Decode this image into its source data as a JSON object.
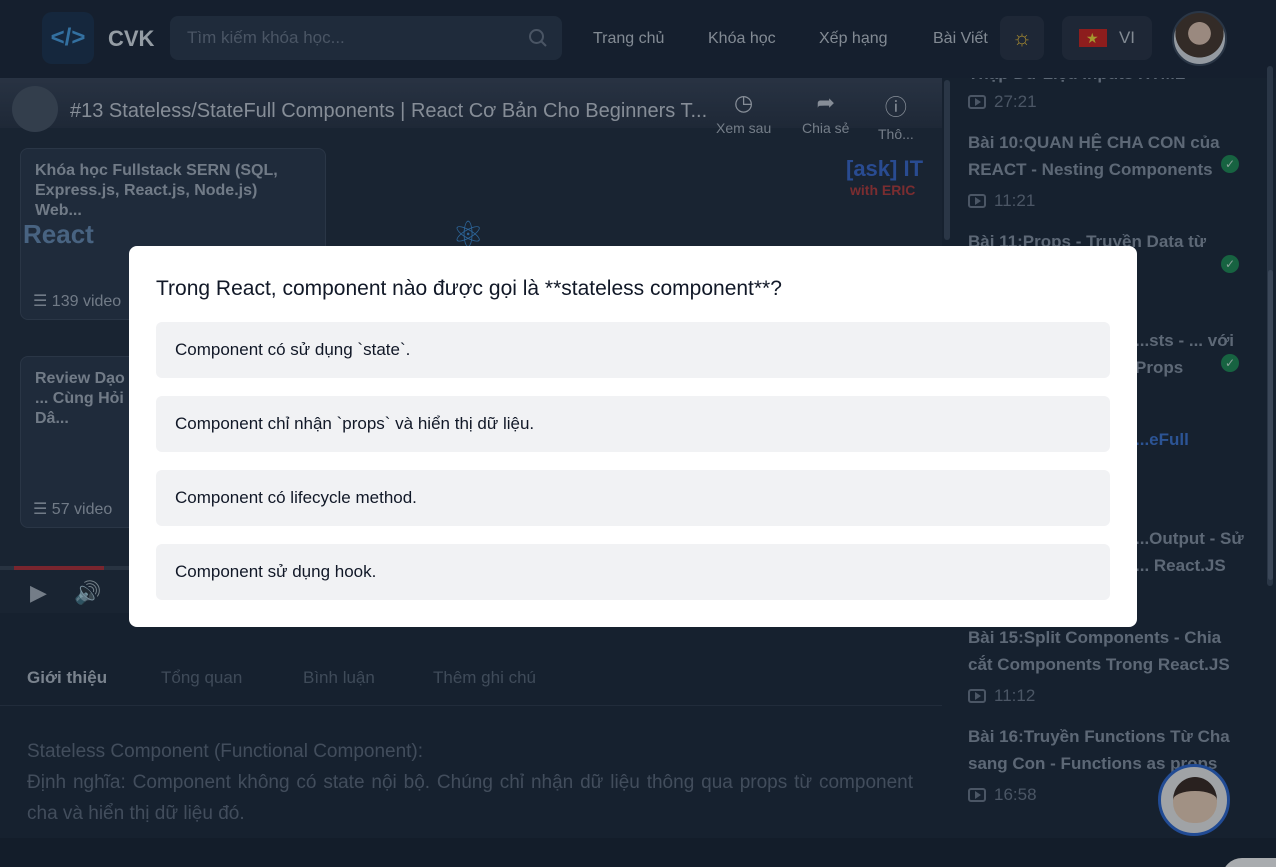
{
  "header": {
    "logo_text": "CVK",
    "search_placeholder": "Tìm kiếm khóa học...",
    "nav": [
      "Trang chủ",
      "Khóa học",
      "Xếp hạng",
      "Bài Viết"
    ],
    "lang_label": "VI"
  },
  "video": {
    "title": "#13 Stateless/StateFull Components | React Cơ Bản Cho Beginners T...",
    "controls": [
      "Xem sau",
      "Chia sẻ",
      "Thô..."
    ],
    "cards": [
      {
        "title": "Khóa học Fullstack SERN (SQL, Express.js, React.js, Node.js) Web...",
        "count": "139 video"
      },
      {
        "title": "Review Dạo ... Cùng Hỏi Dâ...",
        "count": "57 video"
      }
    ],
    "brand": "[ask] IT",
    "brand_sub": "with ERIC",
    "react_label": "React"
  },
  "tabs": [
    "Giới thiệu",
    "Tổng quan",
    "Bình luận",
    "Thêm ghi chú"
  ],
  "description": {
    "line1": "Stateless Component (Functional Component):",
    "line2": "Định nghĩa: Component không có state nội bộ. Chúng chỉ nhận dữ liệu thông qua props từ component cha và hiển thị dữ liệu đó."
  },
  "sidebar": {
    "items": [
      {
        "title": "Thập Dữ Liệu Inputs HTML",
        "time": "27:21"
      },
      {
        "title": "Bài 10:QUAN HỆ CHA CON của REACT - Nesting Components",
        "time": "11:21"
      },
      {
        "title": "Bài 11:Props - Truyền Data từ",
        "time": ""
      },
      {
        "title": "...sts - ... với Props",
        "time": ""
      },
      {
        "title": "...eFull",
        "time": ""
      },
      {
        "title": "...Output - Sử ... React.JS",
        "time": ""
      },
      {
        "title": "Bài 15:Split Components - Chia cắt Components Trong React.JS",
        "time": "11:12"
      },
      {
        "title": "Bài 16:Truyền Functions Từ Cha sang Con - Functions as props",
        "time": "16:58"
      }
    ]
  },
  "quiz": {
    "question": "Trong React, component nào được gọi là **stateless component**?",
    "options": [
      "Component có sử dụng `state`.",
      "Component chỉ nhận `props` và hiển thị dữ liệu.",
      "Component có lifecycle method.",
      "Component sử dụng hook."
    ]
  }
}
